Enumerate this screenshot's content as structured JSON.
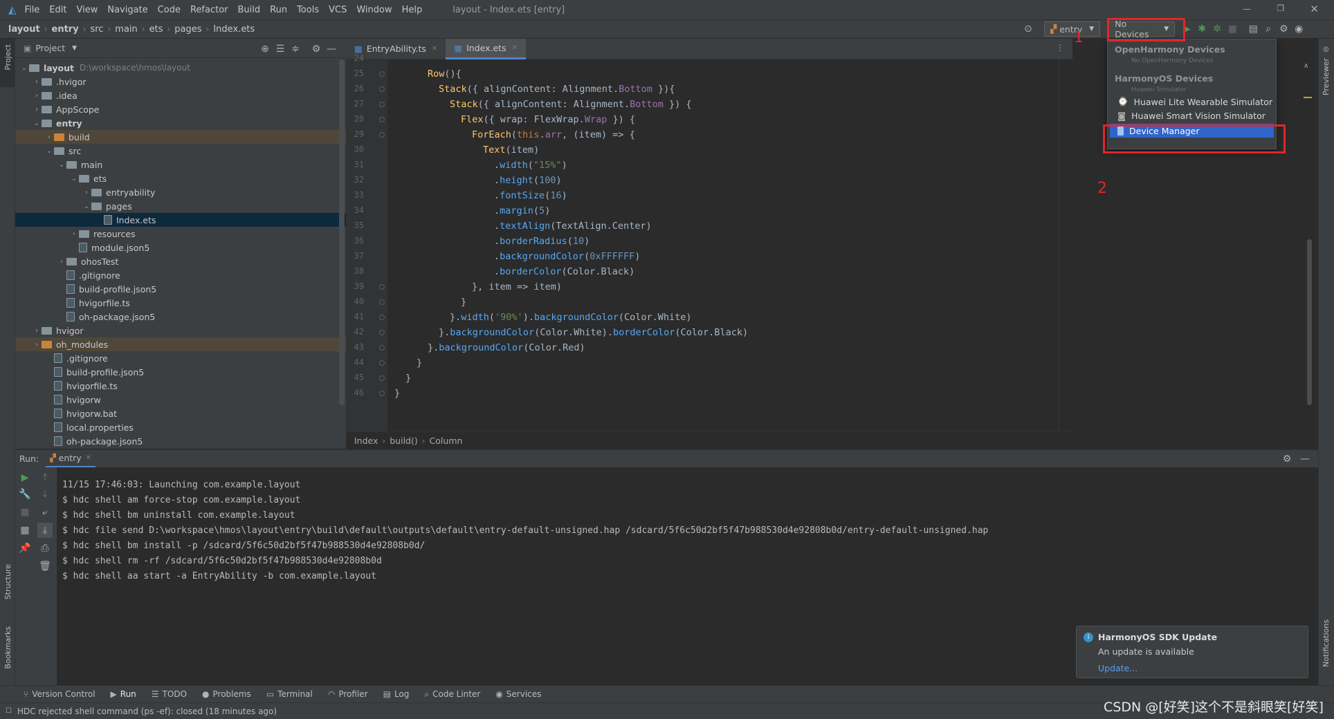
{
  "menubar": {
    "items": [
      "File",
      "Edit",
      "View",
      "Navigate",
      "Code",
      "Refactor",
      "Build",
      "Run",
      "Tools",
      "VCS",
      "Window",
      "Help"
    ],
    "title": "layout - Index.ets [entry]"
  },
  "navbar": {
    "breadcrumbs": [
      "layout",
      "entry",
      "src",
      "main",
      "ets",
      "pages",
      "Index.ets"
    ],
    "run_config": "entry",
    "device_select": "No Devices"
  },
  "sidebar_left": {
    "project_label": "Project",
    "structure_label": "Structure",
    "bookmarks_label": "Bookmarks"
  },
  "project_panel": {
    "title": "Project",
    "root_path": "D:\\workspace\\hmos\\layout",
    "tree": [
      {
        "label": "layout",
        "bold": true
      },
      {
        "label": ".hvigor"
      },
      {
        "label": ".idea"
      },
      {
        "label": "AppScope"
      },
      {
        "label": "entry",
        "bold": true
      },
      {
        "label": "build"
      },
      {
        "label": "src"
      },
      {
        "label": "main"
      },
      {
        "label": "ets"
      },
      {
        "label": "entryability"
      },
      {
        "label": "pages"
      },
      {
        "label": "Index.ets"
      },
      {
        "label": "resources"
      },
      {
        "label": "module.json5"
      },
      {
        "label": "ohosTest"
      },
      {
        "label": ".gitignore"
      },
      {
        "label": "build-profile.json5"
      },
      {
        "label": "hvigorfile.ts"
      },
      {
        "label": "oh-package.json5"
      },
      {
        "label": "hvigor"
      },
      {
        "label": "oh_modules"
      },
      {
        "label": ".gitignore"
      },
      {
        "label": "build-profile.json5"
      },
      {
        "label": "hvigorfile.ts"
      },
      {
        "label": "hvigorw"
      },
      {
        "label": "hvigorw.bat"
      },
      {
        "label": "local.properties"
      },
      {
        "label": "oh-package.json5"
      }
    ]
  },
  "editor": {
    "tabs": [
      "EntryAbility.ts",
      "Index.ets"
    ],
    "line_numbers": [
      "24",
      "25",
      "26",
      "27",
      "28",
      "29",
      "30",
      "31",
      "32",
      "33",
      "34",
      "35",
      "36",
      "37",
      "38",
      "39",
      "40",
      "41",
      "42",
      "43",
      "44",
      "45",
      "46"
    ],
    "breadcrumb": [
      "Index",
      "build()",
      "Column"
    ]
  },
  "device_dropdown": {
    "group1": "OpenHarmony Devices",
    "group1_sub": "No OpenHarmony Devices",
    "group2": "HarmonyOS Devices",
    "group2_sub": "Huawei Simulator",
    "items": [
      "Huawei Lite Wearable Simulator",
      "Huawei Smart Vision Simulator",
      "Device Manager"
    ],
    "annotation_1": "1",
    "annotation_2": "2"
  },
  "run_panel": {
    "label": "Run:",
    "tab": "entry",
    "lines": [
      "11/15 17:46:03: Launching com.example.layout",
      "$ hdc shell am force-stop com.example.layout",
      "$ hdc shell bm uninstall com.example.layout",
      "$ hdc file send D:\\workspace\\hmos\\layout\\entry\\build\\default\\outputs\\default\\entry-default-unsigned.hap /sdcard/5f6c50d2bf5f47b988530d4e92808b0d/entry-default-unsigned.hap",
      "$ hdc shell bm install -p /sdcard/5f6c50d2bf5f47b988530d4e92808b0d/",
      "$ hdc shell rm -rf /sdcard/5f6c50d2bf5f47b988530d4e92808b0d",
      "$ hdc shell aa start -a EntryAbility -b com.example.layout"
    ]
  },
  "tool_windows": [
    "Version Control",
    "Run",
    "TODO",
    "Problems",
    "Terminal",
    "Profiler",
    "Log",
    "Code Linter",
    "Services"
  ],
  "status": "HDC rejected shell command (ps -ef): closed (18 minutes ago)",
  "notification": {
    "title": "HarmonyOS SDK Update",
    "body": "An update is available",
    "link": "Update..."
  },
  "right_strip": {
    "previewer": "Previewer",
    "notifications": "Notifications"
  },
  "watermark": "CSDN @[好笑]这个不是斜眼笑[好笑]",
  "colors": {
    "accent": "#4a88c7",
    "selection": "#2f65ca",
    "annotation": "#e0262a"
  }
}
